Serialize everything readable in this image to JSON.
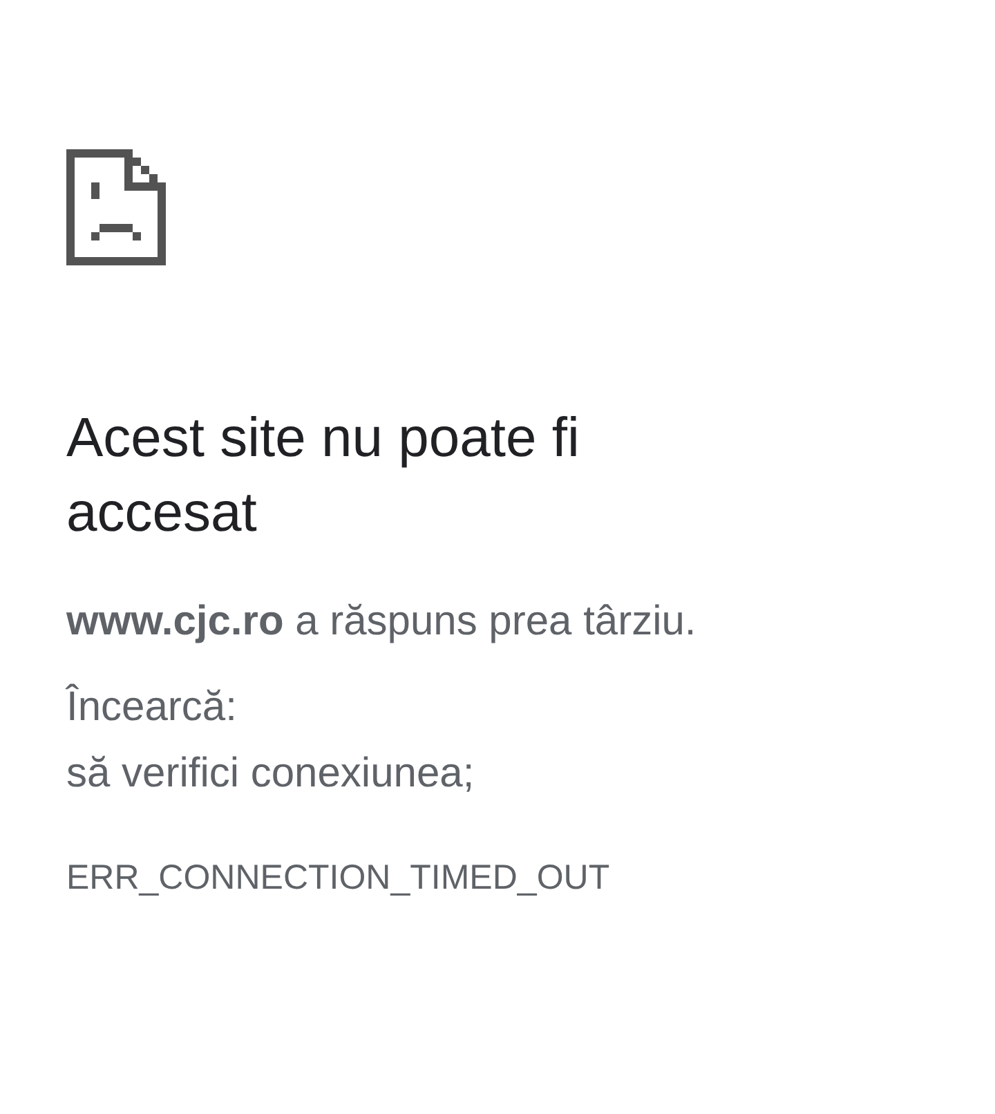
{
  "error_page": {
    "title": "Acest site nu poate fi accesat",
    "message": "**www.cjc.ro** a răspuns prea târziu.",
    "suggestions_heading": "Încearcă:",
    "suggestions": [
      "să verifici conexiunea;"
    ],
    "error_code": "ERR_CONNECTION_TIMED_OUT"
  }
}
